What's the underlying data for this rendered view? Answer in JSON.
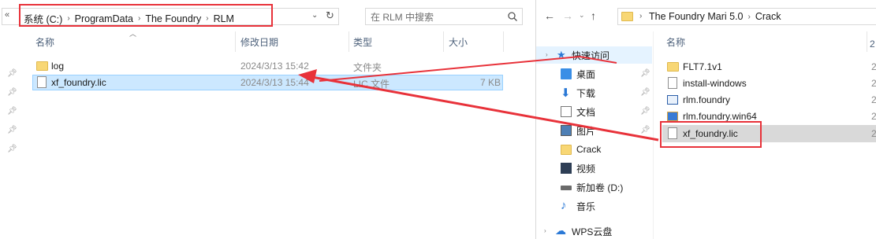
{
  "left": {
    "breadcrumb": [
      "系统 (C:)",
      "ProgramData",
      "The Foundry",
      "RLM"
    ],
    "search_placeholder": "在 RLM 中搜索",
    "columns": [
      "名称",
      "修改日期",
      "类型",
      "大小"
    ],
    "files": [
      {
        "name": "log",
        "date": "2024/3/13 15:42",
        "type": "文件夹",
        "size": "",
        "icon": "folder-icon"
      },
      {
        "name": "xf_foundry.lic",
        "date": "2024/3/13 15:44",
        "type": "LIC 文件",
        "size": "7 KB",
        "icon": "file-icon"
      }
    ]
  },
  "right": {
    "breadcrumb": [
      "The Foundry Mari 5.0",
      "Crack"
    ],
    "column": "名称",
    "nav": [
      {
        "label": "快速访问",
        "icon": "star-icon"
      },
      {
        "label": "桌面",
        "icon": "desktop-icon"
      },
      {
        "label": "下载",
        "icon": "download-icon"
      },
      {
        "label": "文档",
        "icon": "document-icon"
      },
      {
        "label": "图片",
        "icon": "picture-icon"
      },
      {
        "label": "Crack",
        "icon": "folder-icon"
      },
      {
        "label": "视频",
        "icon": "video-icon"
      },
      {
        "label": "新加卷 (D:)",
        "icon": "drive-icon"
      },
      {
        "label": "音乐",
        "icon": "music-icon"
      },
      {
        "label": "WPS云盘",
        "icon": "cloud-icon"
      }
    ],
    "files": [
      {
        "name": "FLT7.1v1",
        "icon": "folder-icon"
      },
      {
        "name": "install-windows",
        "icon": "file-icon"
      },
      {
        "name": "rlm.foundry",
        "icon": "app-icon"
      },
      {
        "name": "rlm.foundry.win64",
        "icon": "app-icon"
      },
      {
        "name": "xf_foundry.lic",
        "icon": "file-icon"
      }
    ],
    "truncated_col": "2"
  },
  "colors": {
    "annotation": "#e8323a",
    "selection": "#cce8ff",
    "folder": "#f8d775"
  }
}
